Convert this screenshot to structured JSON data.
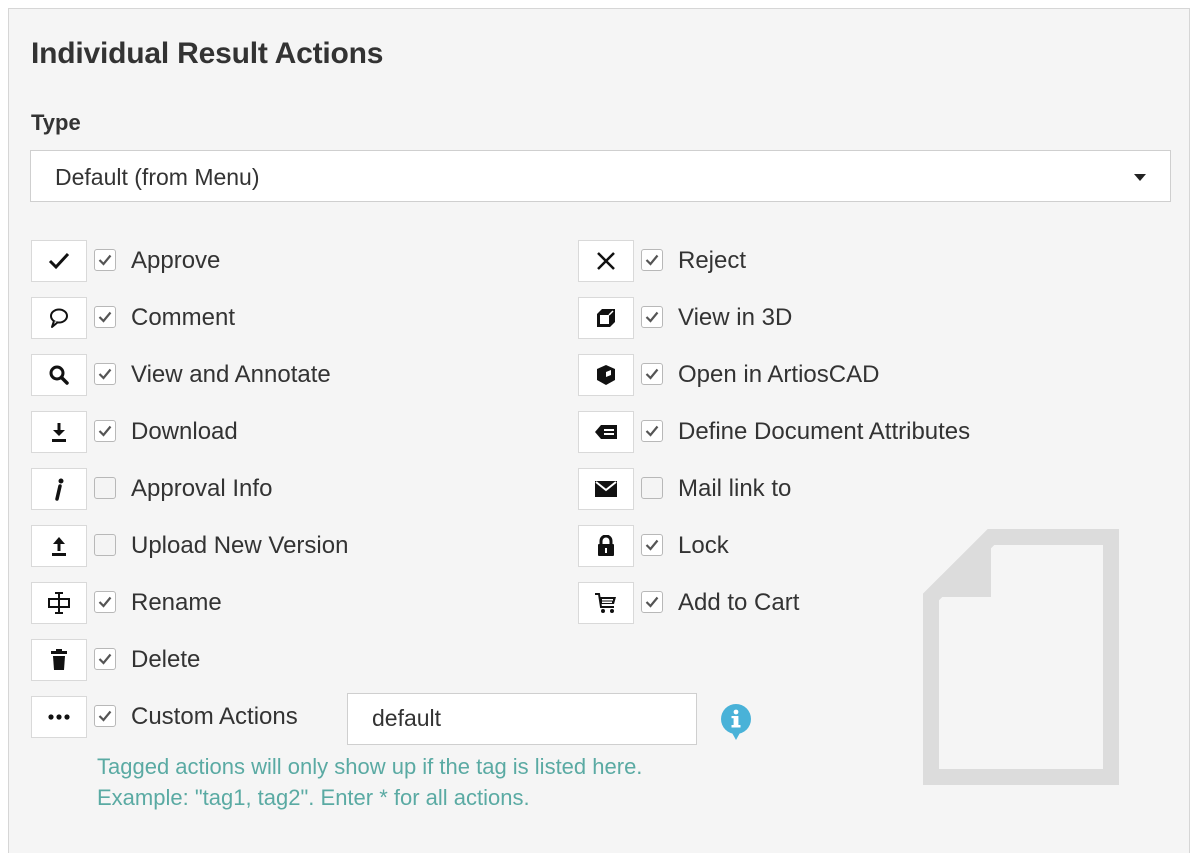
{
  "panel": {
    "title": "Individual Result Actions",
    "type_label": "Type",
    "type_select": {
      "selected": "Default (from Menu)"
    }
  },
  "actions_left": [
    {
      "icon": "check-icon",
      "label": "Approve",
      "checked": true
    },
    {
      "icon": "comment-icon",
      "label": "Comment",
      "checked": true
    },
    {
      "icon": "search-icon",
      "label": "View and Annotate",
      "checked": true
    },
    {
      "icon": "download-icon",
      "label": "Download",
      "checked": true
    },
    {
      "icon": "info-italic-icon",
      "label": "Approval Info",
      "checked": false
    },
    {
      "icon": "upload-icon",
      "label": "Upload New Version",
      "checked": false
    },
    {
      "icon": "rename-icon",
      "label": "Rename",
      "checked": true
    },
    {
      "icon": "trash-icon",
      "label": "Delete",
      "checked": true
    },
    {
      "icon": "ellipsis-icon",
      "label": "Custom Actions",
      "checked": true
    }
  ],
  "actions_right": [
    {
      "icon": "close-icon",
      "label": "Reject",
      "checked": true
    },
    {
      "icon": "cube-icon",
      "label": "View in 3D",
      "checked": true
    },
    {
      "icon": "artioscad-icon",
      "label": "Open in ArtiosCAD",
      "checked": true
    },
    {
      "icon": "tag-icon",
      "label": "Define Document Attributes",
      "checked": true
    },
    {
      "icon": "envelope-icon",
      "label": "Mail link to",
      "checked": false
    },
    {
      "icon": "lock-icon",
      "label": "Lock",
      "checked": true
    },
    {
      "icon": "cart-icon",
      "label": "Add to Cart",
      "checked": true
    }
  ],
  "custom_actions": {
    "input_value": "default",
    "help_line1": "Tagged actions will only show up if the tag is listed here.",
    "help_line2": "Example: \"tag1, tag2\". Enter * for all actions."
  },
  "colors": {
    "panel_bg": "#f5f5f5",
    "help_text": "#5aaaa3",
    "info_icon": "#49b2d8",
    "watermark": "#dcdcdc"
  }
}
